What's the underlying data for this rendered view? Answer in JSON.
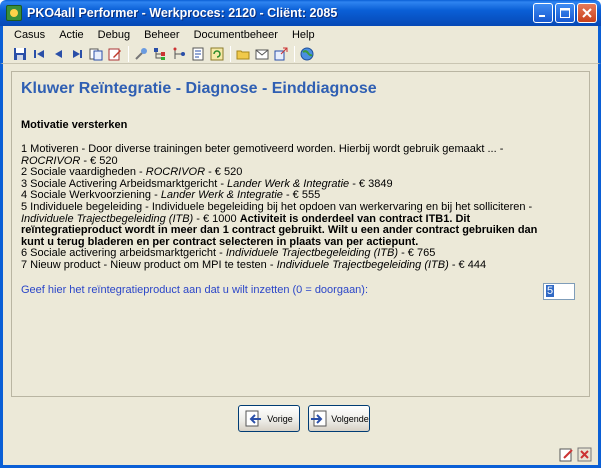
{
  "window": {
    "title": "PKO4all Performer - Werkproces: 2120 - Cliënt: 2085",
    "controls": [
      "minimize",
      "maximize",
      "close"
    ]
  },
  "menu": {
    "items": [
      "Casus",
      "Actie",
      "Debug",
      "Beheer",
      "Documentbeheer",
      "Help"
    ]
  },
  "toolbar": {
    "icons": [
      "save-icon",
      "first-icon",
      "previous-icon",
      "next-icon",
      "copy-icon",
      "edit-icon",
      "tool-icon",
      "tree-icon",
      "branch-icon",
      "document-icon",
      "refresh-icon",
      "folder-icon",
      "mail-icon",
      "export-icon",
      "globe-icon"
    ]
  },
  "main": {
    "heading": "Kluwer Reïntegratie - Diagnose - Einddiagnose",
    "subheading": "Motivatie versterken",
    "items": {
      "item1_a": "1 Motiveren - Door diverse trainingen beter gemotiveerd worden. Hierbij wordt gebruik gemaakt ... -",
      "item1_b_italic": "ROCRIVOR",
      "item1_b_rest": " - € 520",
      "item2_a": "2 Sociale vaardigheden - ",
      "item2_italic": "ROCRIVOR",
      "item2_rest": " - € 520",
      "item3_a": "3 Sociale Activering Arbeidsmarktgericht - ",
      "item3_italic": "Lander Werk & Integratie",
      "item3_rest": " - € 3849",
      "item4_a": "4 Sociale Werkvoorziening - ",
      "item4_italic": "Lander Werk & Integratie",
      "item4_rest": " - € 555",
      "item5_a": "5 Individuele begeleiding - Individuele begeleiding bij het opdoen van werkervaring en bij het solliciteren -",
      "item5_italic": "Individuele Trajectbegeleiding (ITB)",
      "item5_rest": " - € 1000 ",
      "item5_bold_1": "Activiteit is onderdeel van contract ITB1. Dit",
      "item5_bold_2": "reïntegratieproduct wordt in meer dan 1 contract gebruikt. Wilt u een ander contract gebruiken dan",
      "item5_bold_3": "kunt u terug bladeren en per contract selecteren in plaats van per actiepunt.",
      "item6_a": "6 Sociale activering arbeidsmarktgericht - ",
      "item6_italic": "Individuele Trajectbegeleiding (ITB)",
      "item6_rest": " - € 765",
      "item7_a": "7 Nieuw product - Nieuw product om MPI te testen - ",
      "item7_italic": "Individuele Trajectbegeleiding (ITB)",
      "item7_rest": " - € 444"
    },
    "prompt": "Geef hier het reïntegratieproduct aan dat u wilt inzetten (0 = doorgaan):",
    "answer_value": "5"
  },
  "buttons": {
    "previous_label": "Vorige",
    "next_label": "Volgende"
  },
  "colors": {
    "titlebar": "#0a5fd6",
    "heading": "#2f5fb3",
    "prompt": "#2b46c8",
    "frame_bg": "#ece9d8"
  }
}
